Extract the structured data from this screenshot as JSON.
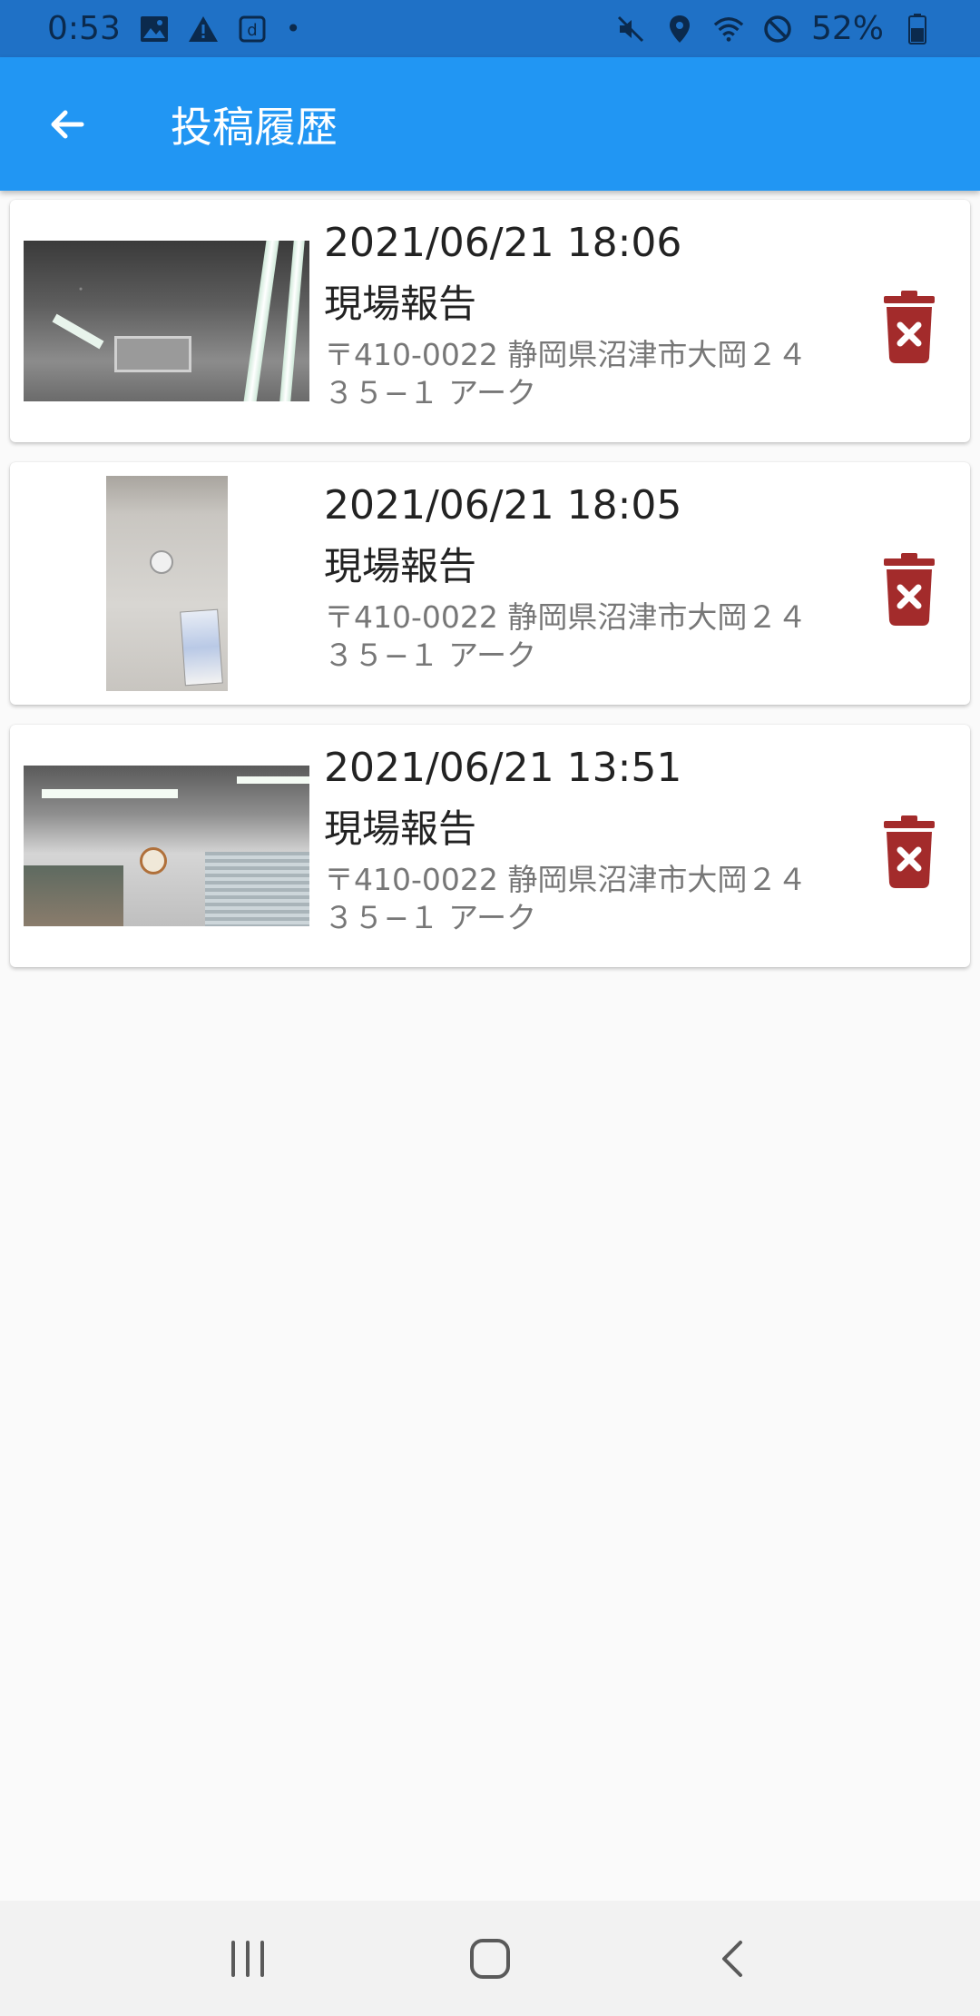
{
  "status_bar": {
    "time": "0:53",
    "left_icons": [
      "gallery-icon",
      "warning-icon",
      "d-app-icon"
    ],
    "dot": "•",
    "right_icons": [
      "mute-icon",
      "location-icon",
      "wifi-icon",
      "dnd-icon",
      "battery-icon"
    ],
    "battery": "52%"
  },
  "app_bar": {
    "back_icon": "arrow-left-icon",
    "title": "投稿履歴",
    "color": "#2196f3"
  },
  "posts": [
    {
      "datetime": "2021/06/21 18:06",
      "title": "現場報告",
      "address": "〒410-0022 静岡県沼津市大岡２４３５−１ アーク"
    },
    {
      "datetime": "2021/06/21 18:05",
      "title": "現場報告",
      "address": "〒410-0022 静岡県沼津市大岡２４３５−１ アーク"
    },
    {
      "datetime": "2021/06/21 13:51",
      "title": "現場報告",
      "address": "〒410-0022 静岡県沼津市大岡２４３５−１ アーク"
    }
  ],
  "delete_icon": "trash-x-icon",
  "delete_color": "#a32b2b",
  "nav_bar": {
    "icons": [
      "recents-icon",
      "home-icon",
      "back-icon"
    ]
  }
}
